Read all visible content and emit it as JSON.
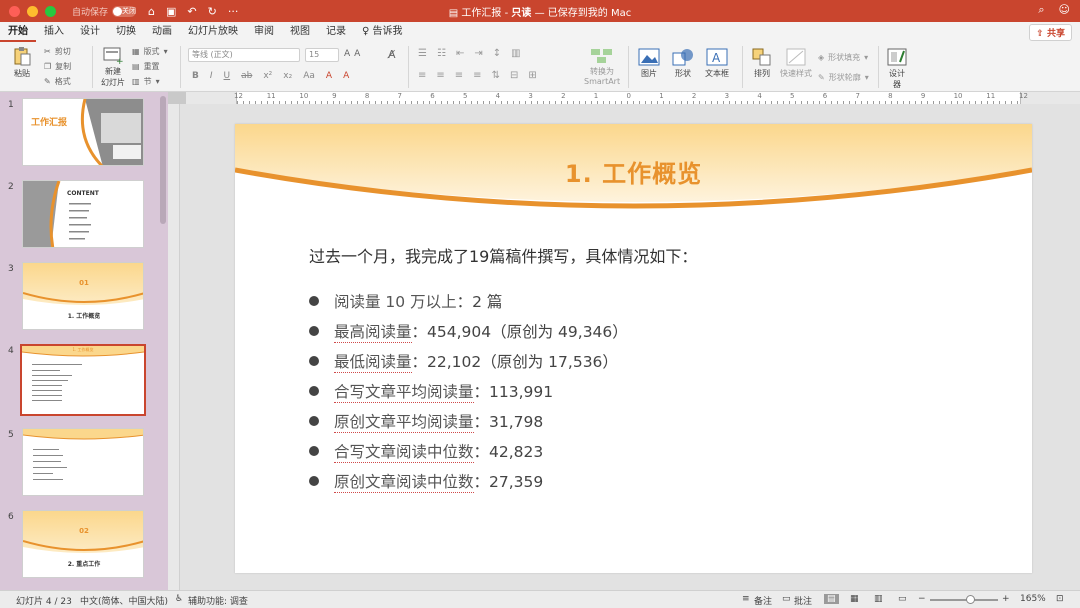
{
  "titlebar": {
    "autosave_label": "自动保存",
    "autosave_state": "关闭",
    "doc_name": "工作汇报",
    "doc_mode": "只读",
    "doc_status": "— 已保存到我的 Mac"
  },
  "menu": {
    "tabs": [
      "开始",
      "插入",
      "设计",
      "切换",
      "动画",
      "幻灯片放映",
      "审阅",
      "视图",
      "记录"
    ],
    "tell_me": "告诉我",
    "share": "共享"
  },
  "ribbon": {
    "paste": "粘贴",
    "cut": "剪切",
    "copy": "复制",
    "format": "格式",
    "new_slide_line1": "新建",
    "new_slide_line2": "幻灯片",
    "layout": "版式",
    "reset": "重置",
    "section": "节",
    "font_name": "等线 (正文)",
    "font_size": "15",
    "convert_line1": "转换为",
    "convert_line2": "SmartArt",
    "picture": "图片",
    "shape": "形状",
    "textbox": "文本框",
    "arrange": "排列",
    "quick_styles": "快速样式",
    "shape_fill": "形状填充",
    "shape_outline": "形状轮廓",
    "designer_line1": "设计",
    "designer_line2": "器",
    "format_buttons": [
      "B",
      "I",
      "U",
      "ab",
      "x²",
      "x₂",
      "Aa",
      "A",
      "A"
    ]
  },
  "ruler": {
    "top_numbers": [
      "12",
      "11",
      "10",
      "9",
      "8",
      "7",
      "6",
      "5",
      "4",
      "3",
      "2",
      "1",
      "0",
      "1",
      "2",
      "3",
      "4",
      "5",
      "6",
      "7",
      "8",
      "9",
      "10",
      "11",
      "12"
    ]
  },
  "thumbnails": [
    {
      "num": "1",
      "title": "工作汇报"
    },
    {
      "num": "2",
      "title": "CONTENT"
    },
    {
      "num": "3",
      "title": "01",
      "subtitle": "1. 工作概览"
    },
    {
      "num": "4",
      "title": "1. 工作概览"
    },
    {
      "num": "5",
      "title": ""
    },
    {
      "num": "6",
      "title": "02",
      "subtitle": "2. 重点工作"
    }
  ],
  "slide": {
    "title": "1. 工作概览",
    "intro": "过去一个月，我完成了19篇稿件撰写，具体情况如下：",
    "bullets": [
      {
        "label": "阅读量 10 万以上",
        "value": "：2 篇"
      },
      {
        "label": "最高阅读量",
        "value": "：454,904（原创为 49,346）"
      },
      {
        "label": "最低阅读量",
        "value": "：22,102（原创为 17,536）"
      },
      {
        "label": "合写文章平均阅读量",
        "value": "：113,991"
      },
      {
        "label": "原创文章平均阅读量",
        "value": "：31,798"
      },
      {
        "label": "合写文章阅读中位数",
        "value": "：42,823"
      },
      {
        "label": "原创文章阅读中位数",
        "value": "：27,359"
      }
    ]
  },
  "status": {
    "slide_pos": "幻灯片 4 / 23",
    "language": "中文(简体、中国大陆)",
    "accessibility": "辅助功能: 调查",
    "notes": "备注",
    "comments": "批注",
    "zoom": "165%"
  },
  "colors": {
    "accent": "#c9452e",
    "slide_title": "#e8922d",
    "slide_band": "#fbd78c"
  }
}
